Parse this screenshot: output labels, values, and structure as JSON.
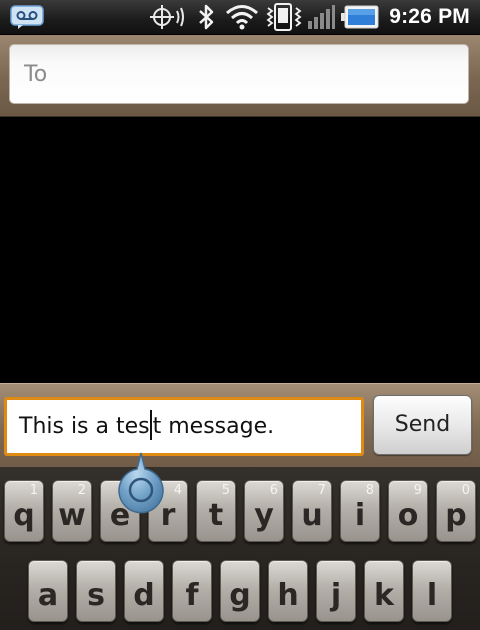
{
  "status_bar": {
    "time": "9:26 PM",
    "icons": [
      "voicemail-icon",
      "location-icon",
      "bluetooth-icon",
      "wifi-icon",
      "vibrate-icon",
      "signal-icon",
      "battery-icon"
    ],
    "battery_color": "#2f7fd8"
  },
  "recipient": {
    "placeholder": "To"
  },
  "compose": {
    "text_before_cursor": "This is a tes",
    "text_after_cursor": "t message.",
    "send_label": "Send",
    "focus_color": "#e08a16"
  },
  "keyboard": {
    "row1": [
      {
        "letter": "q",
        "number": "1"
      },
      {
        "letter": "w",
        "number": "2"
      },
      {
        "letter": "e",
        "number": "3"
      },
      {
        "letter": "r",
        "number": "4"
      },
      {
        "letter": "t",
        "number": "5"
      },
      {
        "letter": "y",
        "number": "6"
      },
      {
        "letter": "u",
        "number": "7"
      },
      {
        "letter": "i",
        "number": "8"
      },
      {
        "letter": "o",
        "number": "9"
      },
      {
        "letter": "p",
        "number": "0"
      }
    ],
    "row2": [
      {
        "letter": "a"
      },
      {
        "letter": "s"
      },
      {
        "letter": "d"
      },
      {
        "letter": "f"
      },
      {
        "letter": "g"
      },
      {
        "letter": "h"
      },
      {
        "letter": "j"
      },
      {
        "letter": "k"
      },
      {
        "letter": "l"
      }
    ]
  }
}
